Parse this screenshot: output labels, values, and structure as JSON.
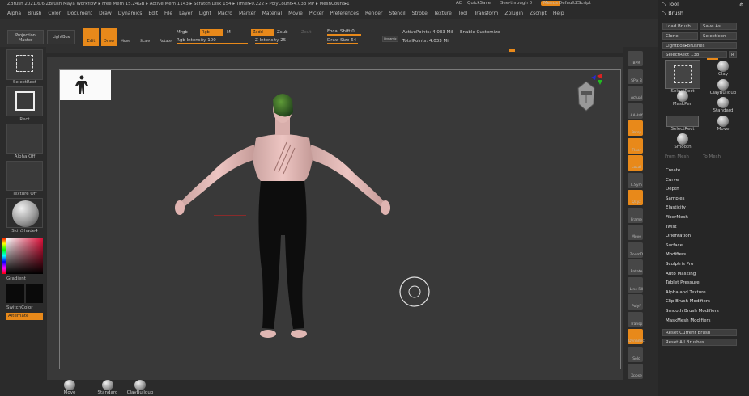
{
  "title_bar": {
    "text": "ZBrush 2021.6.6 ZBrush Maya Workflow  ▸ Free Mem 15.24GB ▸ Active Mem 1143 ▸ Scratch Disk 154 ▸ Timer▸0.222 ▸ PolyCount▸4.033 MP ▸ MeshCount▸1",
    "ac": "AC",
    "quicksave": "QuickSave",
    "see_through": "See-through  0",
    "menus": "Menus",
    "default_zscript": "DefaultZScript"
  },
  "menus": [
    "Alpha",
    "Brush",
    "Color",
    "Document",
    "Draw",
    "Dynamics",
    "Edit",
    "File",
    "Layer",
    "Light",
    "Macro",
    "Marker",
    "Material",
    "Movie",
    "Picker",
    "Preferences",
    "Render",
    "Stencil",
    "Stroke",
    "Texture",
    "Tool",
    "Transform",
    "Zplugin",
    "Zscript",
    "Help"
  ],
  "toolbar": {
    "projection_master": "Projection Master",
    "lightbox": "LightBox",
    "edit": "Edit",
    "draw": "Draw",
    "move": "Move",
    "scale": "Scale",
    "rotate": "Rotate",
    "mrgb": "Mrgb",
    "rgb": "Rgb",
    "m": "M",
    "rgb_intensity": "Rgb Intensity 100",
    "zadd": "Zadd",
    "zsub": "Zsub",
    "zcut": "Zcut",
    "z_intensity": "Z Intensity 25",
    "focal_shift": "Focal Shift 0",
    "draw_size": "Draw Size 64",
    "dynamic": "Dynamic",
    "active_points": "ActivePoints: 4.033 Mil",
    "total_points": "TotalPoints: 4.033 Mil",
    "enable_customize": "Enable Customize"
  },
  "left_panel": {
    "select_rect": "SelectRect",
    "rect": "Rect",
    "alpha": "Alpha Off",
    "texture": "Texture Off",
    "material": "SkinShade4",
    "gradient": "Gradient",
    "switch_color": "SwitchColor",
    "alternate": "Alternate"
  },
  "right_shelf": [
    "BPR",
    "SPix 3",
    "Actual",
    "AAHalf",
    "Persp",
    "Floor",
    "Local",
    "L.Sym",
    "Qxyz",
    "Frame",
    "Move",
    "ZoomD",
    "Rotate",
    "Line Fill",
    "PolyF",
    "Transp",
    "Dynamic",
    "Solo",
    "Xpose"
  ],
  "tool_panel": {
    "tool": "Tool",
    "brush": "Brush",
    "load_brush": "Load Brush",
    "save_as": "Save As",
    "clone": "Clone",
    "selecticon": "SelectIcon",
    "lightbox_brushes": "Lightbox▸Brushes",
    "selectrect_value": "SelectRect  138",
    "r_label": "R",
    "brushes": [
      "SelectRect",
      "Clay",
      "ClayBuildup",
      "MaskPen",
      "Standard",
      "SelectRect",
      "Move",
      "Smooth"
    ],
    "from_mesh": "From Mesh",
    "to_mesh": "To Mesh",
    "submenu": [
      "Create",
      "Curve",
      "Depth",
      "Samples",
      "Elasticity",
      "FiberMesh",
      "Twist",
      "Orientation",
      "Surface",
      "Modifiers",
      "Sculptris Pro",
      "Auto Masking",
      "Tablet Pressure",
      "Alpha and Texture",
      "Clip Brush Modifiers",
      "Smooth Brush Modifiers",
      "MaskMesh Modifiers"
    ],
    "reset_current": "Reset Current Brush",
    "reset_all": "Reset All Brushes"
  },
  "bottom_brushes": [
    "Move",
    "Standard",
    "ClayBuildup"
  ],
  "colors": {
    "accent": "#e8891a",
    "bg": "#393939",
    "panel": "#2b2b2b"
  }
}
